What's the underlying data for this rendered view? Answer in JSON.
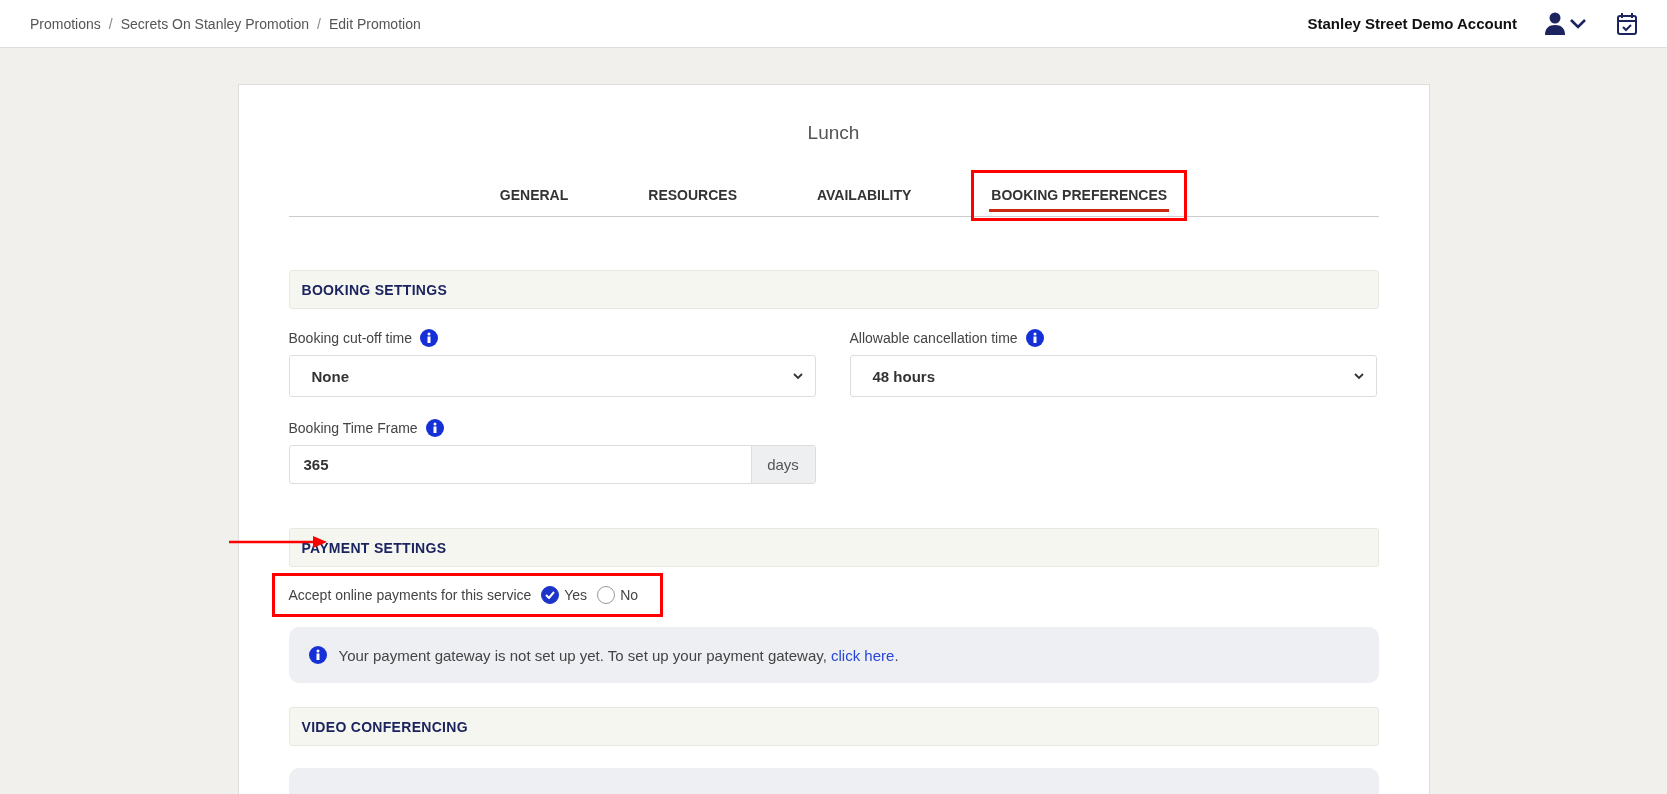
{
  "breadcrumbs": [
    "Promotions",
    "Secrets On Stanley Promotion",
    "Edit Promotion"
  ],
  "breadcrumb_separator": "/",
  "account": {
    "name": "Stanley Street Demo Account"
  },
  "card": {
    "title": "Lunch",
    "tabs": [
      {
        "label": "GENERAL",
        "selected": false,
        "highlighted": false
      },
      {
        "label": "RESOURCES",
        "selected": false,
        "highlighted": false
      },
      {
        "label": "AVAILABILITY",
        "selected": false,
        "highlighted": false
      },
      {
        "label": "BOOKING PREFERENCES",
        "selected": true,
        "highlighted": true
      }
    ],
    "booking_settings": {
      "heading": "BOOKING SETTINGS",
      "cutoff": {
        "label": "Booking cut-off time",
        "value": "None"
      },
      "cancellation": {
        "label": "Allowable cancellation time",
        "value": "48 hours"
      },
      "time_frame": {
        "label": "Booking Time Frame",
        "value": "365",
        "unit": "days"
      }
    },
    "payment_settings": {
      "heading": "PAYMENT SETTINGS",
      "arrow": true,
      "question": {
        "label": "Accept online payments for this service",
        "highlighted": true,
        "options": [
          {
            "label": "Yes",
            "selected": true
          },
          {
            "label": "No",
            "selected": false
          }
        ]
      },
      "notice": {
        "text": "Your payment gateway is not set up yet. To set up your payment gateway,",
        "link": "click here",
        "end": "."
      }
    },
    "video_conferencing": {
      "heading": "VIDEO CONFERENCING"
    }
  }
}
